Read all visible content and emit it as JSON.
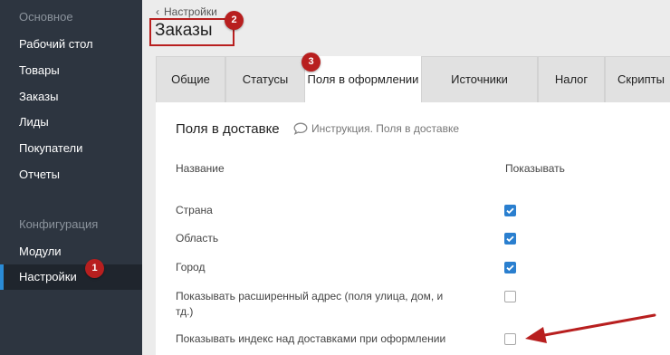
{
  "sidebar": {
    "section1": "Основное",
    "items": [
      {
        "label": "Рабочий стол"
      },
      {
        "label": "Товары"
      },
      {
        "label": "Заказы"
      },
      {
        "label": "Лиды"
      },
      {
        "label": "Покупатели"
      },
      {
        "label": "Отчеты"
      }
    ],
    "section2": "Конфигурация",
    "items2": [
      {
        "label": "Модули"
      },
      {
        "label": "Настройки"
      }
    ]
  },
  "header": {
    "breadcrumb": "Настройки",
    "title": "Заказы"
  },
  "badges": [
    "1",
    "2",
    "3"
  ],
  "tabs": [
    {
      "label": "Общие"
    },
    {
      "label": "Статусы"
    },
    {
      "label": "Поля в оформлении"
    },
    {
      "label": "Источники"
    },
    {
      "label": "Налог"
    },
    {
      "label": "Скрипты"
    }
  ],
  "section": {
    "title": "Поля в доставке",
    "help": "Инструкция. Поля в доставке",
    "col_name": "Название",
    "col_show": "Показывать",
    "rows": [
      {
        "label": "Страна",
        "checked": true
      },
      {
        "label": "Область",
        "checked": true
      },
      {
        "label": "Город",
        "checked": true
      },
      {
        "label": "Показывать расширенный адрес (поля улица, дом, и тд.)",
        "checked": false
      },
      {
        "label": "Показывать индекс над доставками при оформлении",
        "checked": false
      }
    ]
  },
  "colors": {
    "sidebar_bg": "#2d3540",
    "accent": "#2a7fcf",
    "annotation": "#b81f1f"
  }
}
